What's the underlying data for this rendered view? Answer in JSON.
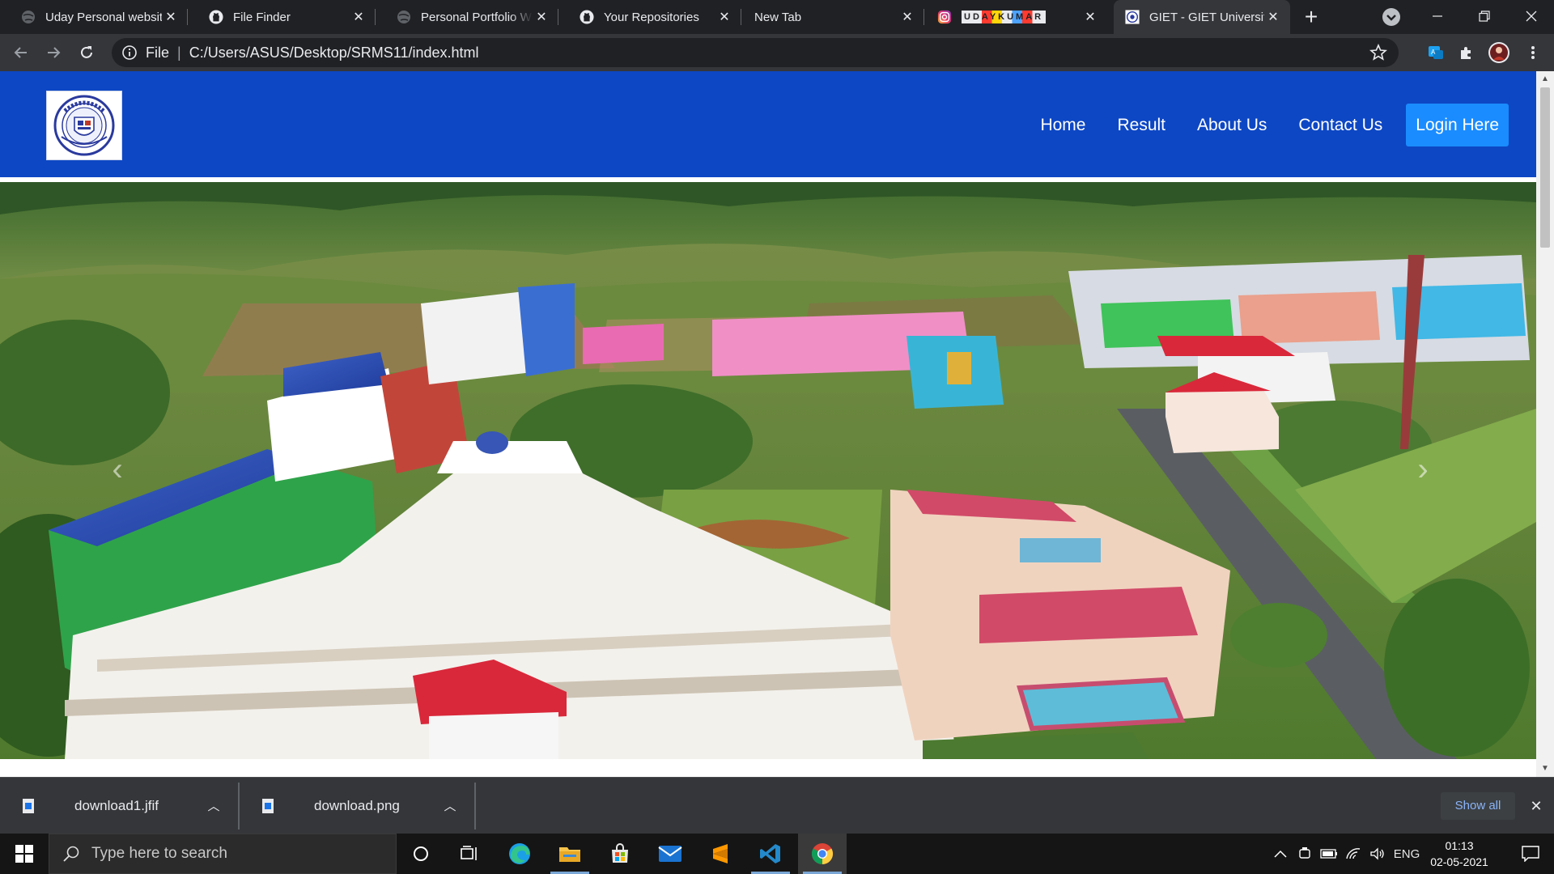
{
  "browser": {
    "tabs": [
      {
        "title": "Uday Personal website",
        "icon": "globe-icon",
        "active": false
      },
      {
        "title": "File Finder",
        "icon": "github-icon",
        "active": false
      },
      {
        "title": "Personal Portfolio Website",
        "icon": "globe-icon",
        "active": false
      },
      {
        "title": "Your Repositories",
        "icon": "github-icon",
        "active": false
      },
      {
        "title": "New Tab",
        "icon": "none",
        "active": false
      },
      {
        "title": "UDAYKUMAR",
        "icon": "instagram-icon",
        "active": false
      },
      {
        "title": "GIET - GIET University",
        "icon": "giet-favicon",
        "active": true
      }
    ],
    "new_tab_label": "+",
    "address": {
      "scheme": "File",
      "url": "C:/Users/ASUS/Desktop/SRMS11/index.html"
    }
  },
  "page": {
    "nav": [
      {
        "label": "Home"
      },
      {
        "label": "Result"
      },
      {
        "label": "About Us"
      },
      {
        "label": "Contact Us"
      }
    ],
    "login_button": "Login Here",
    "hero_image": "aerial photograph of GIET University campus",
    "carousel_prev": "‹",
    "carousel_next": "›"
  },
  "downloads": {
    "items": [
      {
        "name": "download1.jfif"
      },
      {
        "name": "download.png"
      }
    ],
    "show_all": "Show all"
  },
  "taskbar": {
    "search_placeholder": "Type here to search",
    "language": "ENG",
    "time": "01:13",
    "date": "02-05-2021"
  },
  "colors": {
    "navbar": "#0d47c4",
    "login_button": "#1a8cff",
    "browser_dark": "#202124",
    "toolbar": "#35363a"
  }
}
